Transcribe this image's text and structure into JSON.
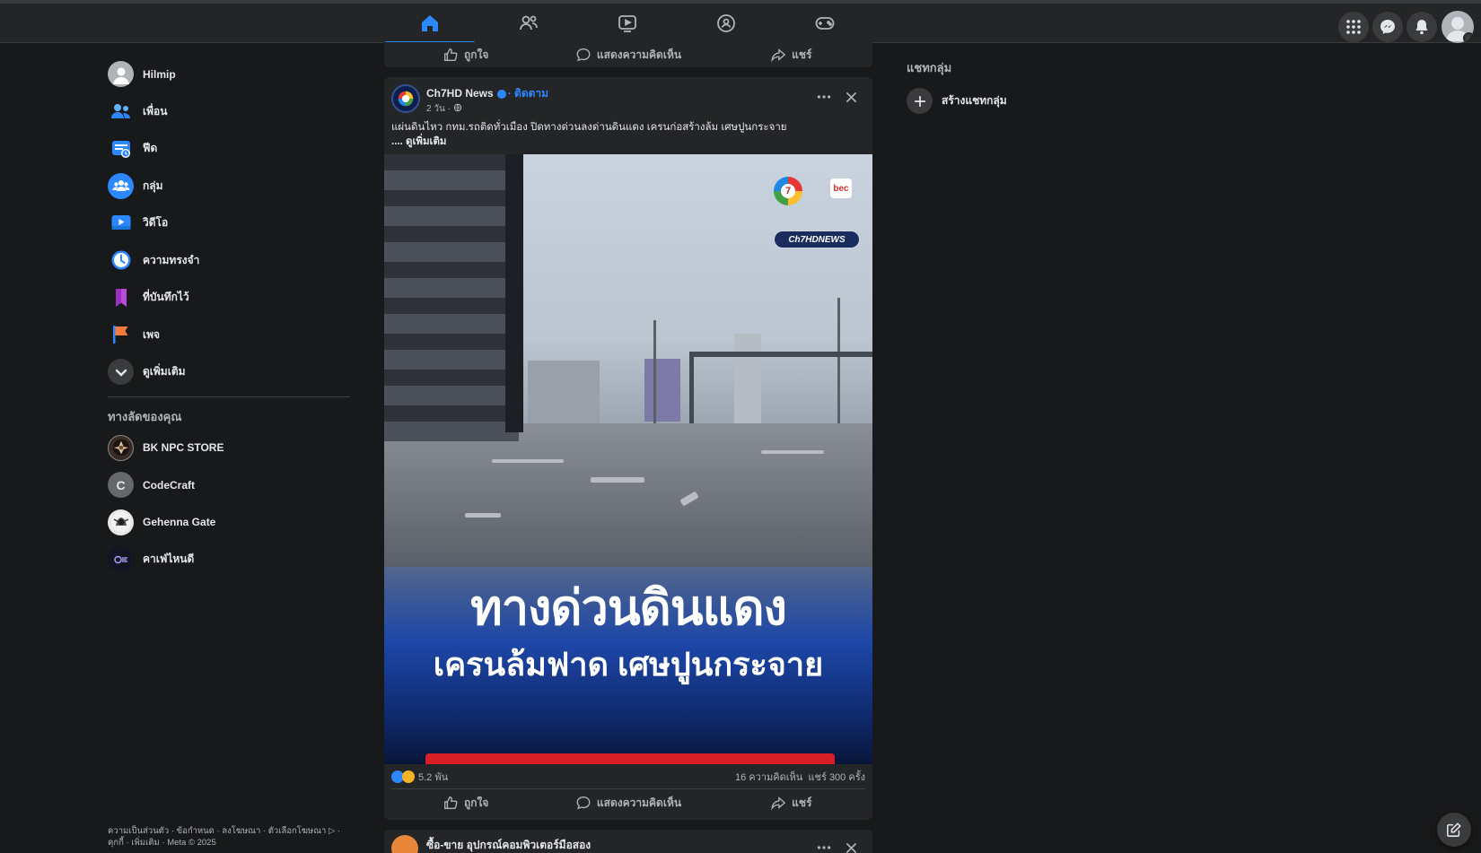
{
  "nav": {
    "tabs": [
      {
        "name": "home",
        "active": true
      },
      {
        "name": "friends",
        "active": false
      },
      {
        "name": "watch",
        "active": false
      },
      {
        "name": "groups",
        "active": false
      },
      {
        "name": "gaming",
        "active": false
      }
    ],
    "right_buttons": [
      "menu-grid-icon",
      "messenger-icon",
      "notifications-icon",
      "profile-avatar"
    ]
  },
  "left_nav": {
    "user": "Hilmip",
    "items": [
      {
        "label": "เพื่อน",
        "icon": "friends-icon"
      },
      {
        "label": "ฟีด",
        "icon": "feed-icon"
      },
      {
        "label": "กลุ่ม",
        "icon": "groups-icon"
      },
      {
        "label": "วิดีโอ",
        "icon": "video-icon"
      },
      {
        "label": "ความทรงจำ",
        "icon": "memories-icon"
      },
      {
        "label": "ที่บันทึกไว้",
        "icon": "saved-icon"
      },
      {
        "label": "เพจ",
        "icon": "pages-icon"
      },
      {
        "label": "ดูเพิ่มเติม",
        "icon": "chevron-down-icon"
      }
    ],
    "shortcuts_title": "ทางลัดของคุณ",
    "shortcuts": [
      {
        "label": "BK NPC STORE",
        "initial": ""
      },
      {
        "label": "CodeCraft",
        "initial": "C"
      },
      {
        "label": "Gehenna Gate",
        "initial": ""
      },
      {
        "label": "คาเฟ่ไหนดี",
        "initial": ""
      }
    ],
    "footer": "ความเป็นส่วนตัว · ข้อกำหนด · ลงโฆษณา · ตัวเลือกโฆษณา ▷ · คุกกี้ · เพิ่มเติม · Meta © 2025"
  },
  "actions": {
    "like": "ถูกใจ",
    "comment": "แสดงความคิดเห็น",
    "share": "แชร์"
  },
  "post": {
    "page_name": "Ch7HD News",
    "follow": "ติดตาม",
    "time": "2 วัน ·",
    "text": "แผ่นดินไหว กทม.รถติดทั่วเมือง ปิดทางด่วนลงด่านดินแดง เครนก่อสร้างล้ม เศษปูนกระจาย",
    "see_more": ".... ดูเพิ่มเติม",
    "image_title": "ทางด่วนดินแดง",
    "image_subtitle": "เครนล้มฟาด เศษปูนกระจาย",
    "image_badge": "Ch7HDNEWS",
    "image_logo_7": "7",
    "image_logo_bec": "bec",
    "reactions": "5.2 พัน",
    "comments": "16 ความคิดเห็น",
    "shares": "แชร์ 300 ครั้ง"
  },
  "next_post": {
    "page_name": "ซื้อ-ขาย อุปกรณ์คอมพิวเตอร์มือสอง"
  },
  "right_rail": {
    "title": "แชทกลุ่ม",
    "create": "สร้างแชทกลุ่ม"
  },
  "colors": {
    "accent": "#2d88ff",
    "background": "#18191a",
    "card": "#242526"
  }
}
